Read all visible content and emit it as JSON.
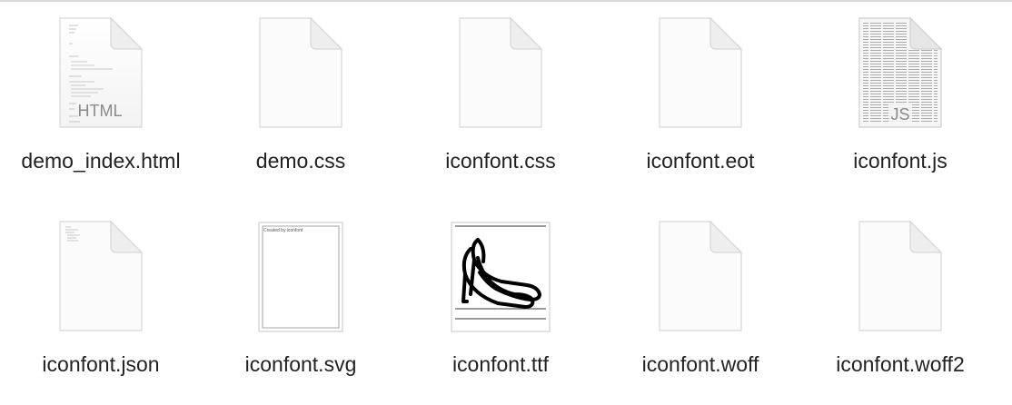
{
  "files": [
    {
      "name": "demo_index.html",
      "icon": "html-file-icon",
      "badge": "HTML"
    },
    {
      "name": "demo.css",
      "icon": "blank-file-icon"
    },
    {
      "name": "iconfont.css",
      "icon": "blank-file-icon"
    },
    {
      "name": "iconfont.eot",
      "icon": "blank-file-icon"
    },
    {
      "name": "iconfont.js",
      "icon": "js-file-icon",
      "badge": "JS"
    },
    {
      "name": "iconfont.json",
      "icon": "json-file-icon"
    },
    {
      "name": "iconfont.svg",
      "icon": "svg-preview-icon",
      "preview_text": "Created by iconfont"
    },
    {
      "name": "iconfont.ttf",
      "icon": "font-preview-icon"
    },
    {
      "name": "iconfont.woff",
      "icon": "blank-file-icon"
    },
    {
      "name": "iconfont.woff2",
      "icon": "blank-file-icon"
    }
  ]
}
